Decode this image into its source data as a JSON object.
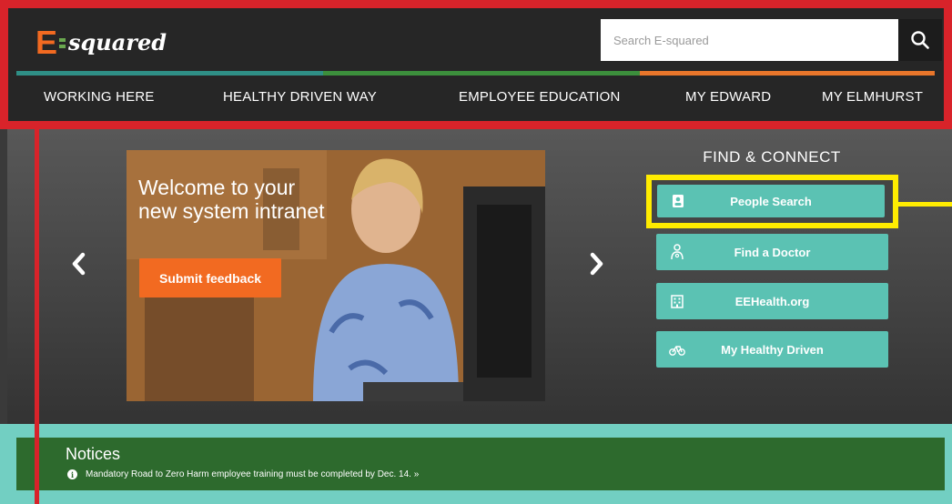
{
  "header": {
    "logo_mark": "E",
    "logo_word": "squared",
    "search_placeholder": "Search E-squared",
    "nav": [
      {
        "label": "WORKING HERE"
      },
      {
        "label": "HEALTHY DRIVEN WAY"
      },
      {
        "label": "EMPLOYEE EDUCATION"
      },
      {
        "label": "MY EDWARD"
      },
      {
        "label": "MY ELMHURST"
      }
    ]
  },
  "hero": {
    "slide_title": "Welcome to your\nnew system intranet",
    "feedback_label": "Submit feedback",
    "prev_icon": "chevron-left-icon",
    "next_icon": "chevron-right-icon"
  },
  "find_connect": {
    "title": "FIND & CONNECT",
    "buttons": [
      {
        "label": "People Search",
        "icon": "id-card-icon"
      },
      {
        "label": "Find a Doctor",
        "icon": "doctor-icon"
      },
      {
        "label": "EEHealth.org",
        "icon": "hospital-icon"
      },
      {
        "label": "My Healthy Driven",
        "icon": "bicycle-icon"
      }
    ]
  },
  "notices": {
    "title": "Notices",
    "items": [
      {
        "text": "Mandatory Road to Zero Harm employee training must be completed by Dec. 14. »",
        "icon": "info-icon"
      }
    ]
  },
  "colors": {
    "header_bg": "#262626",
    "accent_orange": "#f26a21",
    "accent_teal": "#5bc2b3",
    "accent_green": "#2d6a2d",
    "annotation_red": "#d8232a",
    "annotation_yellow": "#ffec00"
  }
}
